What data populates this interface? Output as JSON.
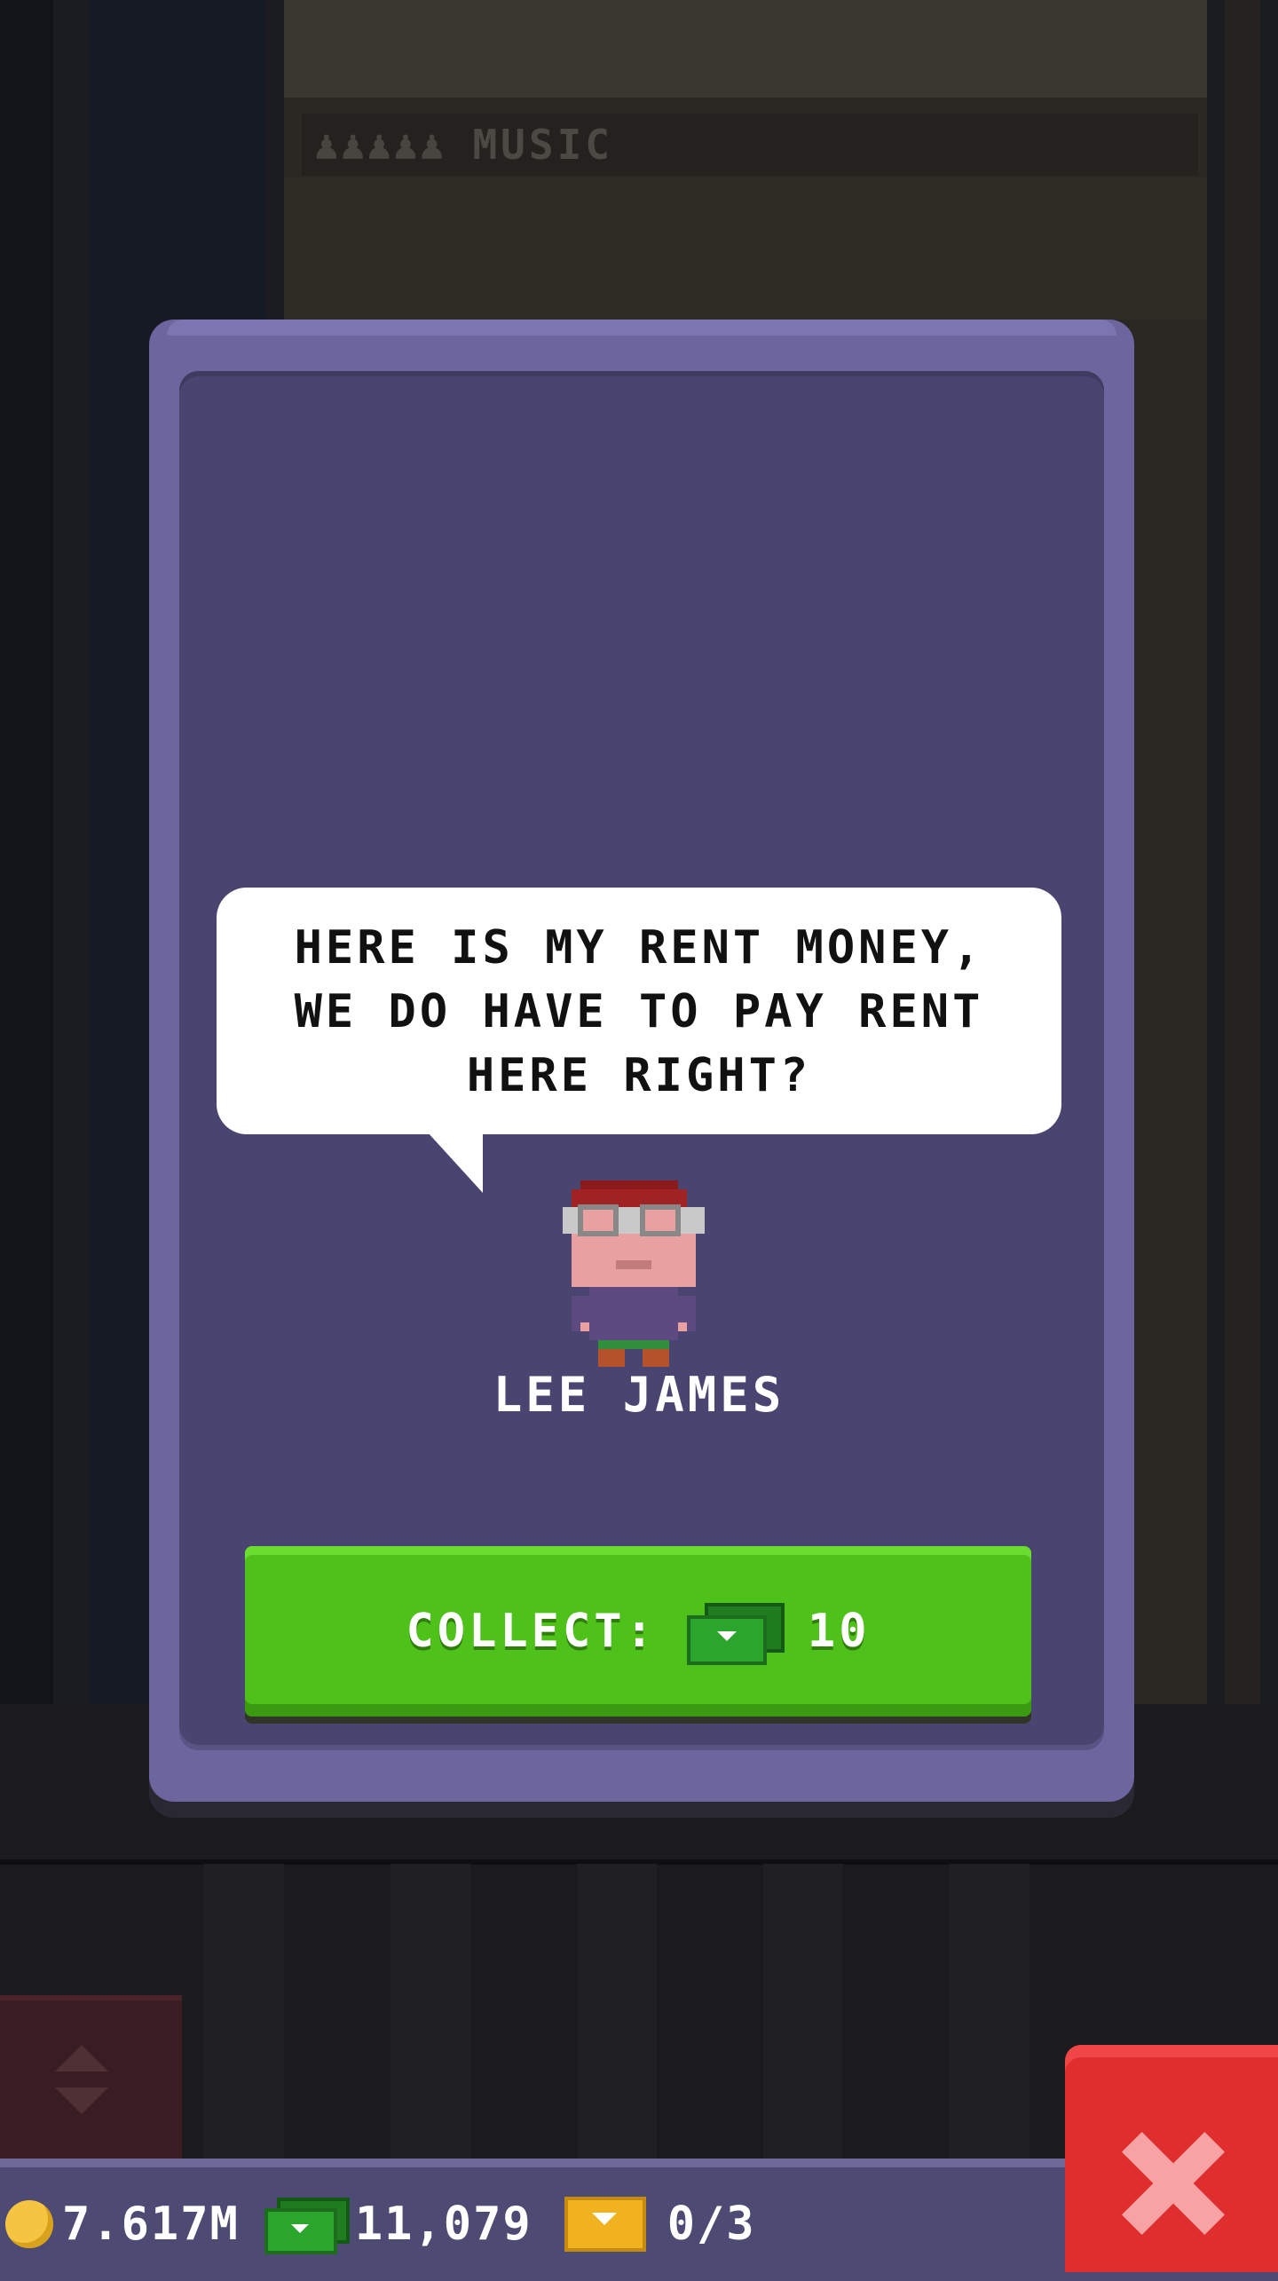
{
  "background_floor": {
    "label": "MUSIC",
    "people_icons": "♟♟♟♟♟"
  },
  "dialog": {
    "speech": "HERE IS MY RENT MONEY,\nWE DO HAVE TO PAY RENT\nHERE RIGHT?",
    "character_name": "LEE JAMES",
    "collect_label": "COLLECT:",
    "collect_amount": "10"
  },
  "hud": {
    "coins": "7.617M",
    "bux": "11,079",
    "tickets": "0/3"
  },
  "colors": {
    "dialog_frame": "#6d659d",
    "dialog_inner": "#4a4570",
    "collect_button": "#4ec11a",
    "close_button": "#e02d2d",
    "coin": "#f5c542",
    "bux": "#2ba52b",
    "ticket": "#f0b21e"
  },
  "icons": {
    "coin": "coin-icon",
    "bux": "bux-icon",
    "ticket": "ticket-icon",
    "close": "close-icon",
    "elevator": "elevator-arrows-icon"
  }
}
